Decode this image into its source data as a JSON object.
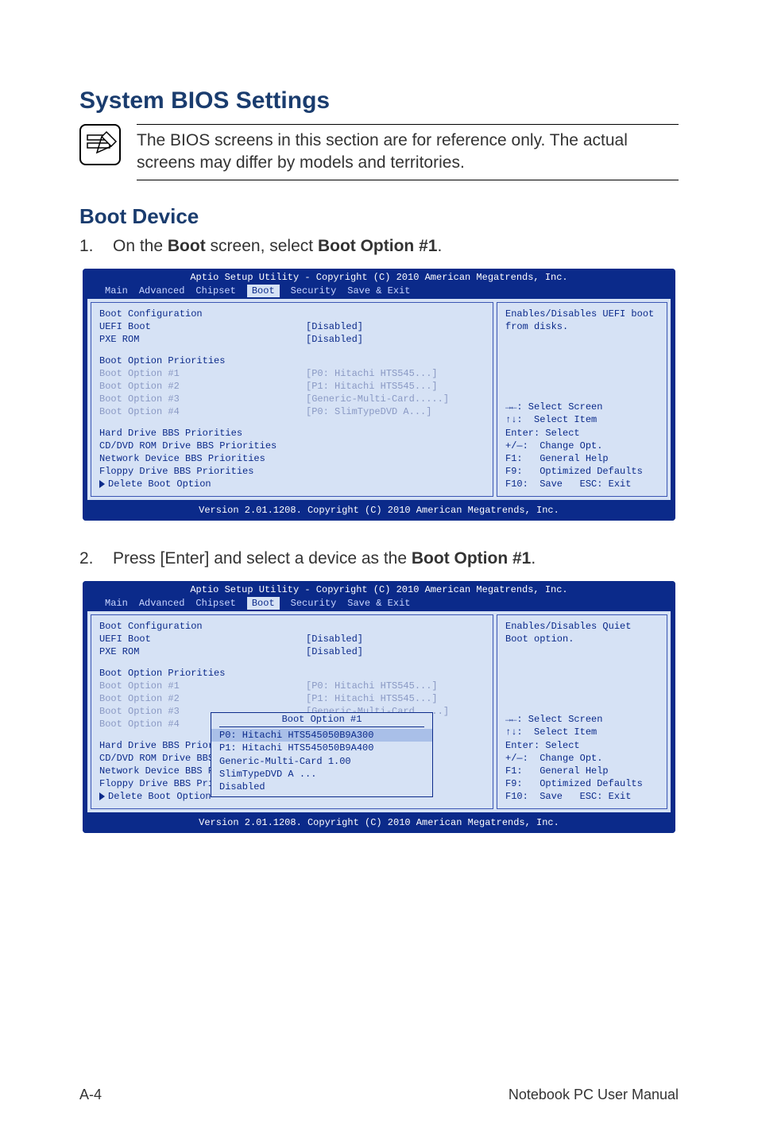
{
  "headings": {
    "h1": "System BIOS Settings",
    "h2": "Boot Device"
  },
  "note": "The BIOS screens in this section are for reference only. The actual screens may differ by models and territories.",
  "steps": {
    "s1_num": "1.",
    "s1_a": "On the ",
    "s1_b": "Boot",
    "s1_c": " screen, select ",
    "s1_d": "Boot Option #1",
    "s1_e": ".",
    "s2_num": "2.",
    "s2_a": "Press [Enter] and select a device as the ",
    "s2_b": "Boot Option #1",
    "s2_c": "."
  },
  "bios_common": {
    "title": "Aptio Setup Utility - Copyright (C) 2010 American Megatrends, Inc.",
    "footer": "Version 2.01.1208. Copyright (C) 2010 American Megatrends, Inc.",
    "tabs": [
      "Main",
      "Advanced",
      "Chipset",
      "Boot",
      "Security",
      "Save & Exit"
    ],
    "conf_head": "Boot Configuration",
    "uefi_label": "UEFI Boot",
    "pxe_label": "PXE ROM",
    "disabled": "[Disabled]",
    "prio_head": "Boot Option Priorities",
    "opt1_label": "Boot Option #1",
    "opt2_label": "Boot Option #2",
    "opt3_label": "Boot Option #3",
    "opt4_label": "Boot Option #4",
    "opt1_val": "[P0: Hitachi HTS545...]",
    "opt2_val": "[P1: Hitachi HTS545...]",
    "opt3_val": "[Generic-Multi-Card.....]",
    "opt4_val": "[P0: SlimTypeDVD A...]",
    "link_hdbbs": "Hard Drive BBS Priorities",
    "link_cddvd": "CD/DVD ROM Drive BBS Priorities",
    "link_net": "Network Device BBS Priorities",
    "link_floppy": "Floppy Drive BBS Priorities",
    "link_del": "Delete Boot Option",
    "help": {
      "l1": "→←: Select Screen",
      "l2": "↑↓:  Select Item",
      "l3": "Enter: Select",
      "l4": "+/—:  Change Opt.",
      "l5": "F1:   General Help",
      "l6": "F9:   Optimized Defaults",
      "l7": "F10:  Save   ESC: Exit"
    }
  },
  "bios1": {
    "right_desc": "Enables/Disables UEFI boot from disks."
  },
  "bios2": {
    "right_desc": "Enables/Disables Quiet Boot option.",
    "link_cddvd_trunc": "CD/DVD ROM Drive BBS Prio",
    "link_net_trunc": "Network Device BBS Prioritie",
    "popup": {
      "title": "Boot Option #1",
      "opts": [
        "P0: Hitachi HTS545050B9A300",
        "P1: Hitachi HTS545050B9A400",
        "Generic-Multi-Card 1.00",
        "SlimTypeDVD A ...",
        "Disabled"
      ]
    }
  },
  "footer": {
    "left": "A-4",
    "right": "Notebook PC User Manual"
  }
}
